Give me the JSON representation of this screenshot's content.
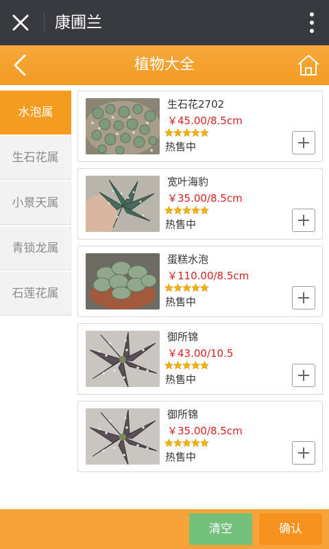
{
  "topbar": {
    "title": "康圃兰"
  },
  "header": {
    "title": "植物大全"
  },
  "sidebar": {
    "items": [
      {
        "label": "水泡属",
        "active": true
      },
      {
        "label": "生石花属",
        "active": false
      },
      {
        "label": "小景天属",
        "active": false
      },
      {
        "label": "青锁龙属",
        "active": false
      },
      {
        "label": "石莲花属",
        "active": false
      }
    ]
  },
  "products": [
    {
      "name": "生石花2702",
      "price": "￥45.00/8.5cm",
      "rating": 5,
      "status": "热售中"
    },
    {
      "name": "宽叶海豹",
      "price": "￥35.00/8.5cm",
      "rating": 5,
      "status": "热售中"
    },
    {
      "name": "蛋糕水泡",
      "price": "￥110.00/8.5cm",
      "rating": 5,
      "status": "热售中"
    },
    {
      "name": "御所锦",
      "price": "￥43.00/10.5",
      "rating": 5,
      "status": "热售中"
    },
    {
      "name": "御所锦",
      "price": "￥35.00/8.5cm",
      "rating": 5,
      "status": "热售中"
    }
  ],
  "footer": {
    "clear_label": "清空",
    "confirm_label": "确认"
  },
  "colors": {
    "accent": "#f59b1f",
    "price": "#d9201f",
    "clear": "#72c07a",
    "star": "#f4b000"
  }
}
